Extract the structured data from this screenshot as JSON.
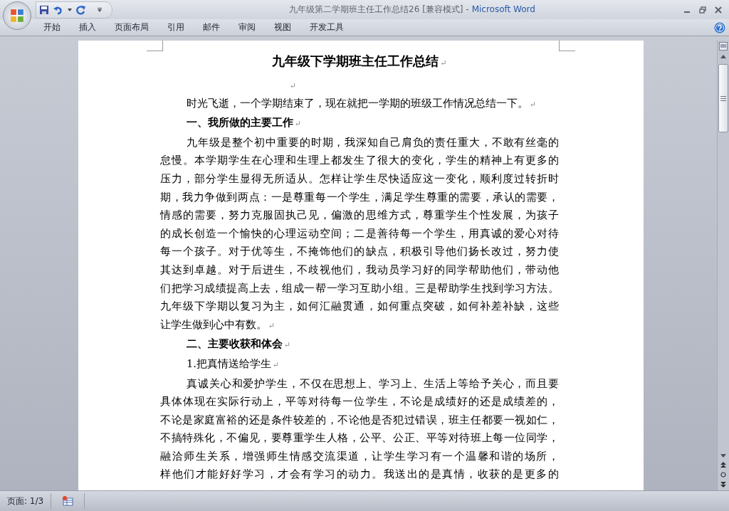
{
  "window": {
    "title": "九年级第二学期班主任工作总结26 [兼容模式] -",
    "app_name": "Microsoft Word"
  },
  "ribbon_tabs": [
    {
      "label": "开始"
    },
    {
      "label": "插入"
    },
    {
      "label": "页面布局"
    },
    {
      "label": "引用"
    },
    {
      "label": "邮件"
    },
    {
      "label": "审阅"
    },
    {
      "label": "视图"
    },
    {
      "label": "开发工具"
    }
  ],
  "document": {
    "blocks": [
      {
        "kind": "title",
        "lines": [
          "九年级下学期班主任工作总结"
        ],
        "end_mark": "↵"
      },
      {
        "kind": "empty",
        "end_mark": "↵"
      },
      {
        "kind": "paragraph",
        "lines": [
          "时光飞逝，一个学期结束了，现在就把一学期的班级工作情况总结一下。"
        ],
        "end_mark": "↵"
      },
      {
        "kind": "heading",
        "lines": [
          "一、我所做的主要工作"
        ],
        "end_mark": "↵"
      },
      {
        "kind": "paragraph",
        "lines": [
          "九年级是整个初中重要的时期，我深知自己肩负的责任重大，不敢有丝毫的",
          "怠慢。本学期学生在心理和生理上都发生了很大的变化，学生的精神上有更多的",
          "压力，部分学生显得无所适从。怎样让学生尽快适应这一变化，顺利度过转折时",
          "期，我力争做到两点：一是尊重每一个学生，满足学生尊重的需要，承认的需要，",
          "情感的需要，努力克服固执己见，偏激的思维方式，尊重学生个性发展，为孩子",
          "的成长创造一个愉快的心理运动空间；二是善待每一个学生，用真诚的爱心对待",
          "每一个孩子。对于优等生，不掩饰他们的缺点，积极引导他们扬长改过，努力使",
          "其达到卓越。对于后进生，不歧视他们，我动员学习好的同学帮助他们，带动他",
          "们把学习成绩提高上去，组成一帮一学习互助小组。三是帮助学生找到学习方法。",
          "九年级下学期以复习为主，如何汇融贯通，如何重点突破，如何补差补缺，这些",
          "让学生做到心中有数。"
        ],
        "end_mark": "↵"
      },
      {
        "kind": "heading",
        "lines": [
          "二、主要收获和体会"
        ],
        "end_mark": "↵"
      },
      {
        "kind": "paragraph",
        "lines": [
          "1.把真情送给学生"
        ],
        "end_mark": "↵"
      },
      {
        "kind": "paragraph",
        "lines": [
          "真诚关心和爱护学生，不仅在思想上、学习上、生活上等给予关心，而且要",
          "具体体现在实际行动上，平等对待每一位学生，不论是成绩好的还是成绩差的，",
          "不论是家庭富裕的还是条件较差的，不论他是否犯过错误，班主任都要一视如仁，",
          "不搞特殊化，不偏见，要尊重学生人格，公平、公正、平等对待班上每一位同学，",
          "融洽师生关系，增强师生情感交流渠道，让学生学习有一个温馨和谐的场所，",
          "样他们才能好好学习，才会有学习的动力。我送出的是真情，收获的是更多的"
        ]
      }
    ]
  },
  "status_bar": {
    "page": "页面: 1/3"
  }
}
